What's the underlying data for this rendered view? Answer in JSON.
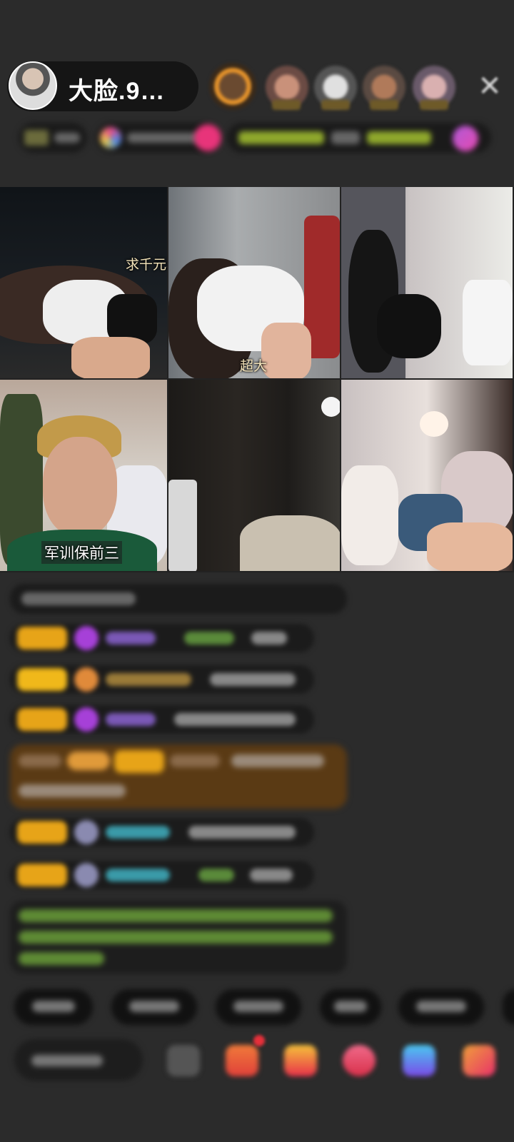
{
  "host": {
    "name": "大脸.9…"
  },
  "viewers": [
    {
      "icon": "viewer-avatar-1"
    },
    {
      "icon": "viewer-avatar-2"
    },
    {
      "icon": "viewer-avatar-3"
    },
    {
      "icon": "viewer-avatar-4"
    },
    {
      "icon": "viewer-avatar-5"
    }
  ],
  "close": {
    "icon": "close-icon",
    "glyph": "✕"
  },
  "video_grid": {
    "tiles": [
      {
        "label": "求千元机"
      },
      {
        "label": "超大"
      },
      {
        "label": ""
      },
      {
        "label": "军训保前三"
      },
      {
        "label": ""
      },
      {
        "label": ""
      }
    ]
  },
  "colors": {
    "background": "#2b2b2b",
    "badge_gold": "#e7a418",
    "gift_banner": "#5a3a14",
    "green_text": "#7fc24a",
    "cyan_text": "#3fb8c8",
    "purple_text": "#9b6bd9"
  },
  "toolbar": {
    "icons": [
      "chat-icon",
      "gift-box-icon",
      "treasure-icon",
      "heart-icon",
      "game-icon",
      "more-gift-icon"
    ]
  }
}
